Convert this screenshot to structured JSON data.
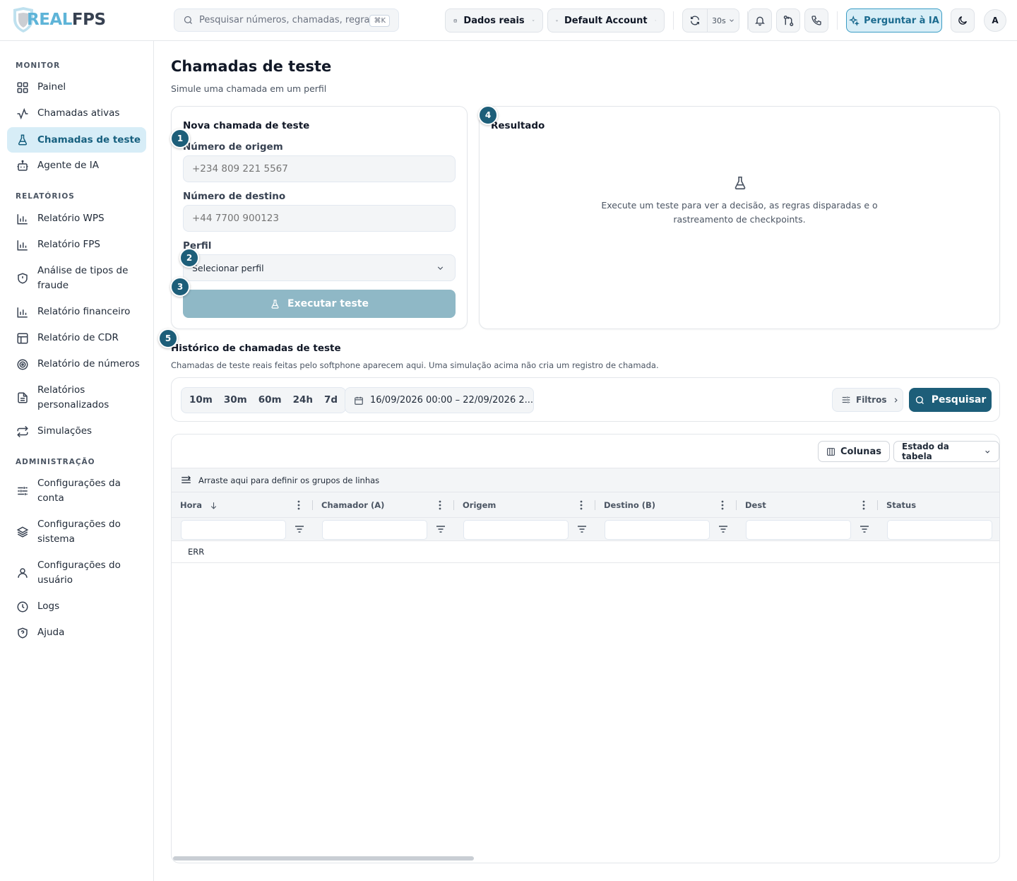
{
  "app": {
    "logo_real": "REAL",
    "logo_fps": "FPS"
  },
  "topbar": {
    "search_placeholder": "Pesquisar números, chamadas, regras...",
    "search_shortcut": "⌘K",
    "data_source": "Dados reais",
    "account": "Default Account",
    "refresh_interval": "30s",
    "ask_ai": "Perguntar à IA",
    "avatar_initial": "A"
  },
  "sidebar": {
    "sections": [
      {
        "title": "MONITOR"
      },
      {
        "title": "RELATÓRIOS"
      },
      {
        "title": "ADMINISTRAÇÃO"
      }
    ],
    "items": [
      {
        "label": "Painel",
        "icon": "grid-icon"
      },
      {
        "label": "Chamadas ativas",
        "icon": "activity-icon"
      },
      {
        "label": "Chamadas de teste",
        "icon": "flask-icon",
        "active": true
      },
      {
        "label": "Agente de IA",
        "icon": "bot-icon"
      },
      {
        "label": "Relatório WPS",
        "icon": "bar-chart-icon"
      },
      {
        "label": "Relatório FPS",
        "icon": "bar-chart-icon"
      },
      {
        "label": "Análise de tipos de fraude",
        "icon": "shield-alert-icon"
      },
      {
        "label": "Relatório financeiro",
        "icon": "bar-chart-icon"
      },
      {
        "label": "Relatório de CDR",
        "icon": "table-icon"
      },
      {
        "label": "Relatório de números",
        "icon": "target-icon"
      },
      {
        "label": "Relatórios personalizados",
        "icon": "file-icon"
      },
      {
        "label": "Simulações",
        "icon": "repeat-icon"
      },
      {
        "label": "Configurações da conta",
        "icon": "sliders-icon"
      },
      {
        "label": "Configurações do sistema",
        "icon": "layers-icon"
      },
      {
        "label": "Configurações do usuário",
        "icon": "user-icon"
      },
      {
        "label": "Logs",
        "icon": "clock-icon"
      },
      {
        "label": "Ajuda",
        "icon": "help-shield-icon"
      }
    ]
  },
  "page": {
    "title": "Chamadas de teste",
    "subtitle": "Simule uma chamada em um perfil"
  },
  "form": {
    "title": "Nova chamada de teste",
    "origin_label": "Número de origem",
    "origin_placeholder": "+234 809 221 5567",
    "destination_label": "Número de destino",
    "destination_placeholder": "+44 7700 900123",
    "profile_label": "Perfil",
    "profile_value": "Selecionar perfil",
    "run_label": "Executar teste"
  },
  "result": {
    "title": "Resultado",
    "empty_text": "Execute um teste para ver a decisão, as regras disparadas e o rastreamento de checkpoints."
  },
  "steps": [
    "1",
    "2",
    "3",
    "4",
    "5"
  ],
  "history": {
    "title": "Histórico de chamadas de teste",
    "subtitle": "Chamadas de teste reais feitas pelo softphone aparecem aqui. Uma simulação acima não cria um registro de chamada.",
    "ranges": [
      "10m",
      "30m",
      "60m",
      "24h",
      "7d"
    ],
    "date_range": "16/09/2026 00:00 – 22/09/2026 2...",
    "filters_label": "Filtros",
    "search_label": "Pesquisar"
  },
  "grid": {
    "columns_button": "Colunas",
    "table_state": "Estado da tabela",
    "group_hint": "Arraste aqui para definir os grupos de linhas",
    "columns": [
      "Hora",
      "Chamador (A)",
      "Origem",
      "Destino (B)",
      "Dest",
      "Status"
    ],
    "rows": [
      [
        "ERR"
      ]
    ]
  },
  "colors": {
    "accent": "#1d5e79",
    "active_bg": "#d7edf7",
    "disabled_btn": "#8fb8c6",
    "logo_blue": "#5eb4d8"
  }
}
